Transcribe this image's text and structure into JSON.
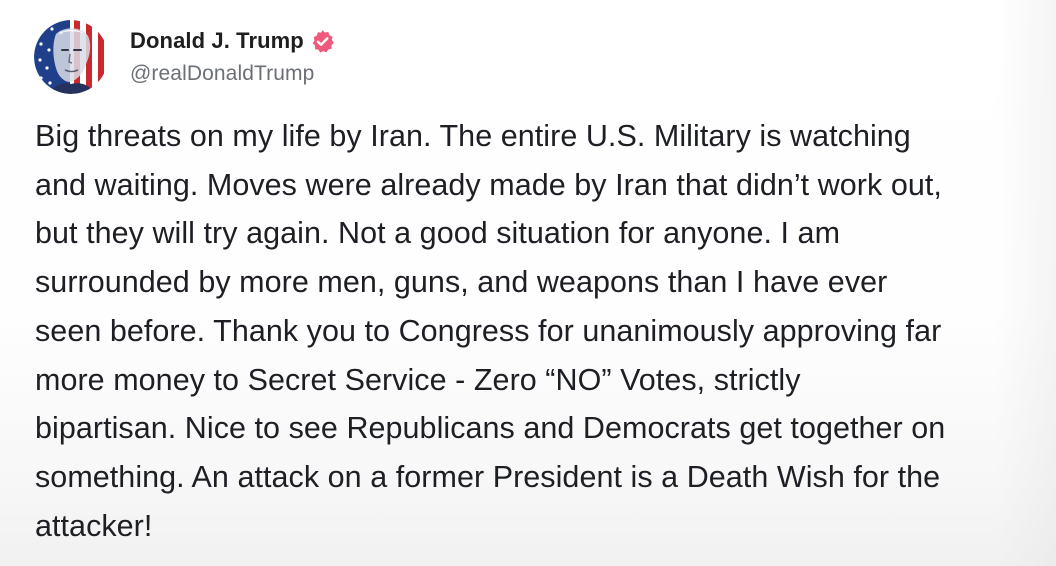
{
  "post": {
    "author": {
      "display_name": "Donald J. Trump",
      "handle": "@realDonaldTrump",
      "verified_badge_icon": "verified-badge-icon",
      "badge_color": "#ef5a7c",
      "avatar_icon": "avatar-image"
    },
    "body_lines": [
      "Big threats on my life by Iran. The entire U.S. Military is watching",
      "and waiting. Moves were already made by Iran that didn’t work out,",
      "but they will try again. Not a good situation for anyone. I am",
      "surrounded by more men, guns, and weapons than I have ever",
      "seen before. Thank you to Congress for unanimously approving far",
      "more money to Secret Service - Zero “NO” Votes, strictly",
      "bipartisan. Nice to see Republicans and Democrats get together on",
      "something. An attack on a former President is a Death Wish for the",
      "attacker!"
    ]
  },
  "colors": {
    "text": "#1d1f24",
    "handle": "#6b6f76",
    "background": "#ffffff"
  }
}
